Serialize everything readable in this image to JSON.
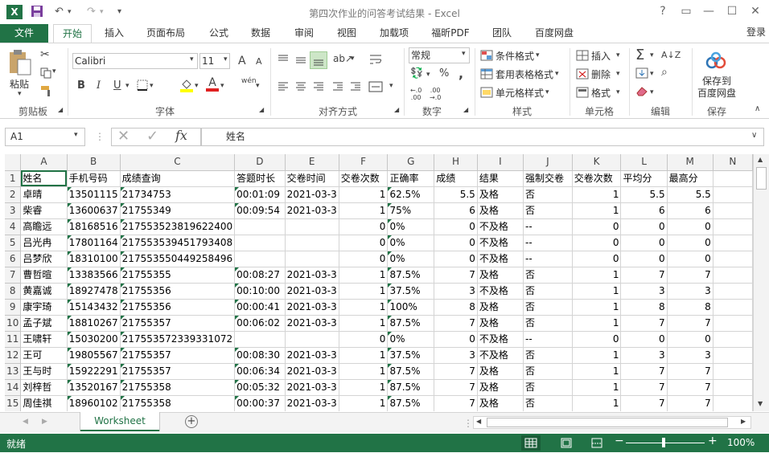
{
  "window": {
    "title": "第四次作业的问答考试结果 - Excel",
    "app_icon": "X",
    "undo_glyph": "↶",
    "redo_glyph": "↷",
    "help": "?",
    "restore": "▭",
    "minimize": "—",
    "maximize": "☐",
    "close": "✕"
  },
  "tabs": [
    "文件",
    "开始",
    "插入",
    "页面布局",
    "公式",
    "数据",
    "审阅",
    "视图",
    "加载项",
    "福昕PDF",
    "团队",
    "百度网盘"
  ],
  "signin": "登录",
  "ribbon": {
    "clipboard": {
      "label": "剪贴板",
      "paste": "粘贴"
    },
    "font": {
      "label": "字体",
      "name": "Calibri",
      "size": "11",
      "bold": "B",
      "italic": "I",
      "underline": "U",
      "grow": "A",
      "shrink": "A",
      "wen": "wén"
    },
    "alignment": {
      "label": "对齐方式"
    },
    "number": {
      "label": "数字",
      "format": "常规",
      "percent": "%",
      "comma": ","
    },
    "styles": {
      "label": "样式",
      "conditional": "条件格式",
      "table": "套用表格格式",
      "cell": "单元格样式"
    },
    "cells": {
      "label": "单元格",
      "insert": "插入",
      "delete": "删除",
      "format": "格式"
    },
    "editing": {
      "label": "编辑",
      "sum": "Σ"
    },
    "save": {
      "label": "保存",
      "button": "保存到\n百度网盘"
    }
  },
  "formula": {
    "namebox": "A1",
    "fx": "fx",
    "content": "姓名",
    "cancel": "✕",
    "confirm": "✓"
  },
  "columns": [
    "A",
    "B",
    "C",
    "D",
    "E",
    "F",
    "G",
    "H",
    "I",
    "J",
    "K",
    "L",
    "M",
    "N"
  ],
  "rows": [
    [
      "姓名",
      "手机号码",
      "成绩查询",
      "答题时长",
      "交卷时间",
      "交卷次数",
      "正确率",
      "成绩",
      "结果",
      "强制交卷",
      "交卷次数",
      "平均分",
      "最高分",
      ""
    ],
    [
      "卓晴",
      "13501115",
      "21734753",
      "00:01:09",
      "2021-03-3",
      "1",
      "62.5%",
      "5.5",
      "及格",
      "否",
      "1",
      "5.5",
      "5.5",
      ""
    ],
    [
      "柴睿",
      "13600637",
      "21755349",
      "00:09:54",
      "2021-03-3",
      "1",
      "75%",
      "6",
      "及格",
      "否",
      "1",
      "6",
      "6",
      ""
    ],
    [
      "高瞻远",
      "18168516",
      "217553523819622400",
      "",
      "",
      "0",
      "0%",
      "0",
      "不及格",
      "--",
      "0",
      "0",
      "0",
      ""
    ],
    [
      "吕光冉",
      "17801164",
      "217553539451793408",
      "",
      "",
      "0",
      "0%",
      "0",
      "不及格",
      "--",
      "0",
      "0",
      "0",
      ""
    ],
    [
      "吕梦欣",
      "18310100",
      "217553550449258496",
      "",
      "",
      "0",
      "0%",
      "0",
      "不及格",
      "--",
      "0",
      "0",
      "0",
      ""
    ],
    [
      "曹哲暄",
      "13383566",
      "21755355",
      "00:08:27",
      "2021-03-3",
      "1",
      "87.5%",
      "7",
      "及格",
      "否",
      "1",
      "7",
      "7",
      ""
    ],
    [
      "黄嘉诚",
      "18927478",
      "21755356",
      "00:10:00",
      "2021-03-3",
      "1",
      "37.5%",
      "3",
      "不及格",
      "否",
      "1",
      "3",
      "3",
      ""
    ],
    [
      "康宇琦",
      "15143432",
      "21755356",
      "00:00:41",
      "2021-03-3",
      "1",
      "100%",
      "8",
      "及格",
      "否",
      "1",
      "8",
      "8",
      ""
    ],
    [
      "孟子斌",
      "18810267",
      "21755357",
      "00:06:02",
      "2021-03-3",
      "1",
      "87.5%",
      "7",
      "及格",
      "否",
      "1",
      "7",
      "7",
      ""
    ],
    [
      "王啸轩",
      "15030200",
      "217553572339331072",
      "",
      "",
      "0",
      "0%",
      "0",
      "不及格",
      "--",
      "0",
      "0",
      "0",
      ""
    ],
    [
      "王可",
      "19805567",
      "21755357",
      "00:08:30",
      "2021-03-3",
      "1",
      "37.5%",
      "3",
      "不及格",
      "否",
      "1",
      "3",
      "3",
      ""
    ],
    [
      "王与时",
      "15922291",
      "21755357",
      "00:06:34",
      "2021-03-3",
      "1",
      "87.5%",
      "7",
      "及格",
      "否",
      "1",
      "7",
      "7",
      ""
    ],
    [
      "刘梓哲",
      "13520167",
      "21755358",
      "00:05:32",
      "2021-03-3",
      "1",
      "87.5%",
      "7",
      "及格",
      "否",
      "1",
      "7",
      "7",
      ""
    ],
    [
      "周佳祺",
      "18960102",
      "21755358",
      "00:00:37",
      "2021-03-3",
      "1",
      "87.5%",
      "7",
      "及格",
      "否",
      "1",
      "7",
      "7",
      ""
    ]
  ],
  "sheet": {
    "name": "Worksheet",
    "add": "+",
    "prev": "◀",
    "next": "▶"
  },
  "status": {
    "ready": "就绪",
    "zoom": "100%",
    "minus": "−",
    "plus": "+"
  }
}
